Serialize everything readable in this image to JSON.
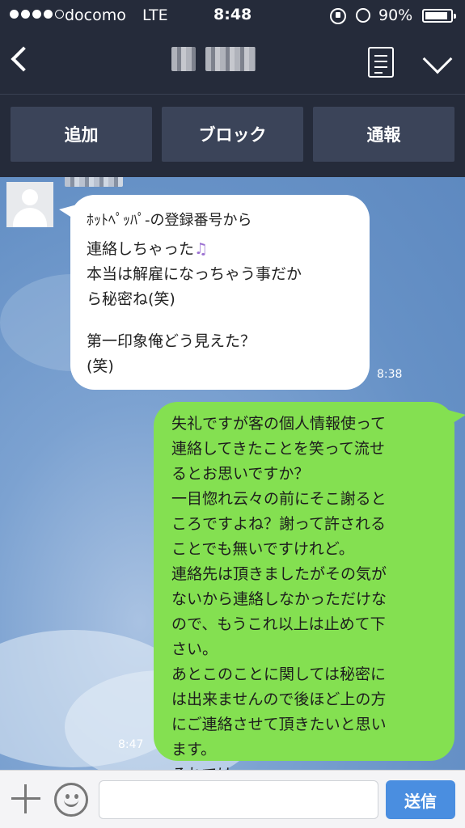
{
  "status_bar": {
    "carrier": "docomo",
    "network": "LTE",
    "time": "8:48",
    "battery_percent": "90%",
    "battery_level": 0.9
  },
  "header": {
    "back_icon": "chevron-left-icon",
    "menu_icon": "notes-icon",
    "expand_icon": "chevron-down-icon"
  },
  "actions": {
    "add": "追加",
    "block": "ブロック",
    "report": "通報"
  },
  "incoming": {
    "lines": [
      "ﾎｯﾄﾍﾟｯﾊﾟ-の登録番号から",
      "連絡しちゃった",
      "本当は解雇になっちゃう事だか",
      "ら秘密ね(笑)",
      "",
      "第一印象俺どう見えた？",
      "(笑)"
    ],
    "emoji": "♫",
    "time": "8:38"
  },
  "outgoing": {
    "lines": [
      "失礼ですが客の個人情報使って",
      "連絡してきたことを笑って流せ",
      "るとお思いですか？",
      "一目惚れ云々の前にそこ謝ると",
      "ころですよね？謝って許される",
      "ことでも無いですけれど。",
      "連絡先は頂きましたがその気が",
      "ないから連絡しなかっただけな",
      "ので、もうこれ以上は止めて下",
      "さい。",
      "あとこのことに関しては秘密に",
      "は出来ませんので後ほど上の方",
      "にご連絡させて頂きたいと思い",
      "ます。",
      "それでは"
    ],
    "time": "8:47"
  },
  "input_bar": {
    "send_label": "送信",
    "message_value": "",
    "plus_icon": "plus-icon",
    "emoji_icon": "smile-icon"
  },
  "colors": {
    "header_bg": "#252b3a",
    "button_bg": "#3b4459",
    "outgoing_bubble": "#84e051",
    "send_button": "#4a8ee0"
  }
}
